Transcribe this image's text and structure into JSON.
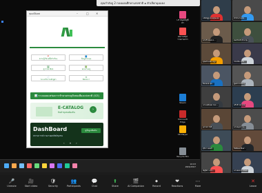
{
  "sharing_banner": "คุณกำลังดู 2 กองแผนศึกษาแห่งชาติ ๑  ตัวเลือกมุมมอง",
  "app_window": {
    "title": "ชุมมณีนิเทศ",
    "menu_buttons": [
      {
        "label": "ความรู้เรื่องหนี้ครัวเรือน",
        "icon": "📍"
      },
      {
        "label": "ข้อมูลกองทุน",
        "icon": "📘"
      },
      {
        "label": "ดูรายละเอียด",
        "icon": "🖼"
      },
      {
        "label": "สอนงานครู",
        "icon": "📗"
      },
      {
        "label": "ระบบบริหารหลักสูตร",
        "icon": "📄"
      },
      {
        "label": "ติดต่อเรา",
        "icon": "✉"
      }
    ],
    "wide_button": "📊 ระบบเผยแพร่ผลการรักษาเศรษฐกิจพอเพียงแห่งชาติ (ICE)",
    "ecatalog": {
      "title": "E-CATALOG",
      "subtitle": "สินค้าชุมชนท้องถิ่น"
    },
    "dashboard": {
      "title": "DashBoard",
      "subtitle": "สถานการณ์รายงานผลลัพธ์ชุมชน",
      "pill": "ดูข้อมูลเพิ่มเติม"
    }
  },
  "desktop_icons": [
    {
      "label": "UF\nสมุดบัญชีคร",
      "color": "#e64980"
    },
    {
      "label": "ผลงานสรุป\nรายงานการ",
      "color": "#fa5252"
    },
    {
      "label": "Steam",
      "color": "#1c7ed6"
    },
    {
      "label": "Microsoft\nEdge",
      "color": "#c92a2a"
    },
    {
      "label": "CR Player",
      "color": "#fab005"
    },
    {
      "label": "Recycle Bin",
      "color": "#868e96"
    }
  ],
  "taskbar": {
    "colors": [
      "#4dabf7",
      "#ffa94d",
      "#74c0fc",
      "#ff6b6b",
      "#69db7c",
      "#ffd43b",
      "#da77f2",
      "#4c6ef5",
      "#20c997",
      "#f783ac"
    ],
    "time": "10:03",
    "date": "28/6/2567"
  },
  "participants": [
    {
      "name": "มณีณัฏฐ์ ดองคุณแสง",
      "bg": "#2f3d4a",
      "body": "#e03131"
    },
    {
      "name": "สำนักงานเขต...",
      "bg": "#4a4a4a",
      "body": "#339af0"
    },
    {
      "name": "นายวีระพงษ์ อ...",
      "bg": "#6b5b4b",
      "body": "#222"
    },
    {
      "name": "สมเกียรติ ชำนาญ",
      "bg": "#3e4f3e",
      "body": "#495057"
    },
    {
      "name": "คุณส่วนเล่ม หนูร",
      "bg": "#5c4a3a",
      "body": "#f59f00"
    },
    {
      "name": "ประเทือง สุริย...",
      "bg": "#3a3a4a",
      "body": "#ced4da"
    },
    {
      "name": "ปิยะพงษ์ สุข...",
      "bg": "#4b5563",
      "body": "#1971c2"
    },
    {
      "name": "ศูนย์การเรียนรู้",
      "bg": "#555",
      "body": "#adb5bd"
    },
    {
      "name": "นายเฉลิมพล ชนะ...",
      "bg": "#3f3f3f",
      "body": "#343a40"
    },
    {
      "name": "อภิรดี ไพโรจน์",
      "bg": "#2c3e50",
      "body": "#e64980"
    },
    {
      "name": "สุภาพร ใจดี",
      "bg": "#5a4636",
      "body": "#495057"
    },
    {
      "name": "นายอนุชา วง...",
      "bg": "#4c4c4c",
      "body": "#868e96"
    },
    {
      "name": "สุริยา ทองคำ",
      "bg": "#3d4b57",
      "body": "#2b8a3e"
    },
    {
      "name": "กิตติพงษ์ พึ่งพา",
      "bg": "#624a3a",
      "body": "#212529"
    },
    {
      "name": "ณัฐธิดา แก้ว...",
      "bg": "#454545",
      "body": "#fa5252"
    },
    {
      "name": "นายสมชาย มั่นคง",
      "bg": "#364152",
      "body": "#ced4da"
    }
  ],
  "controls": [
    {
      "glyph": "🎤",
      "label": "Unmute"
    },
    {
      "glyph": "🎥",
      "label": "Start video"
    },
    {
      "glyph": "🛡",
      "label": "Security"
    },
    {
      "glyph": "👥",
      "label": "Participants"
    },
    {
      "glyph": "💬",
      "label": "Chat"
    },
    {
      "glyph": "⬆",
      "label": "Share"
    },
    {
      "glyph": "🎬",
      "label": "AI Companion"
    },
    {
      "glyph": "⏺",
      "label": "Record"
    },
    {
      "glyph": "❤",
      "label": "Reactions"
    },
    {
      "glyph": "⋯",
      "label": "More"
    }
  ],
  "end_button": "Leave"
}
